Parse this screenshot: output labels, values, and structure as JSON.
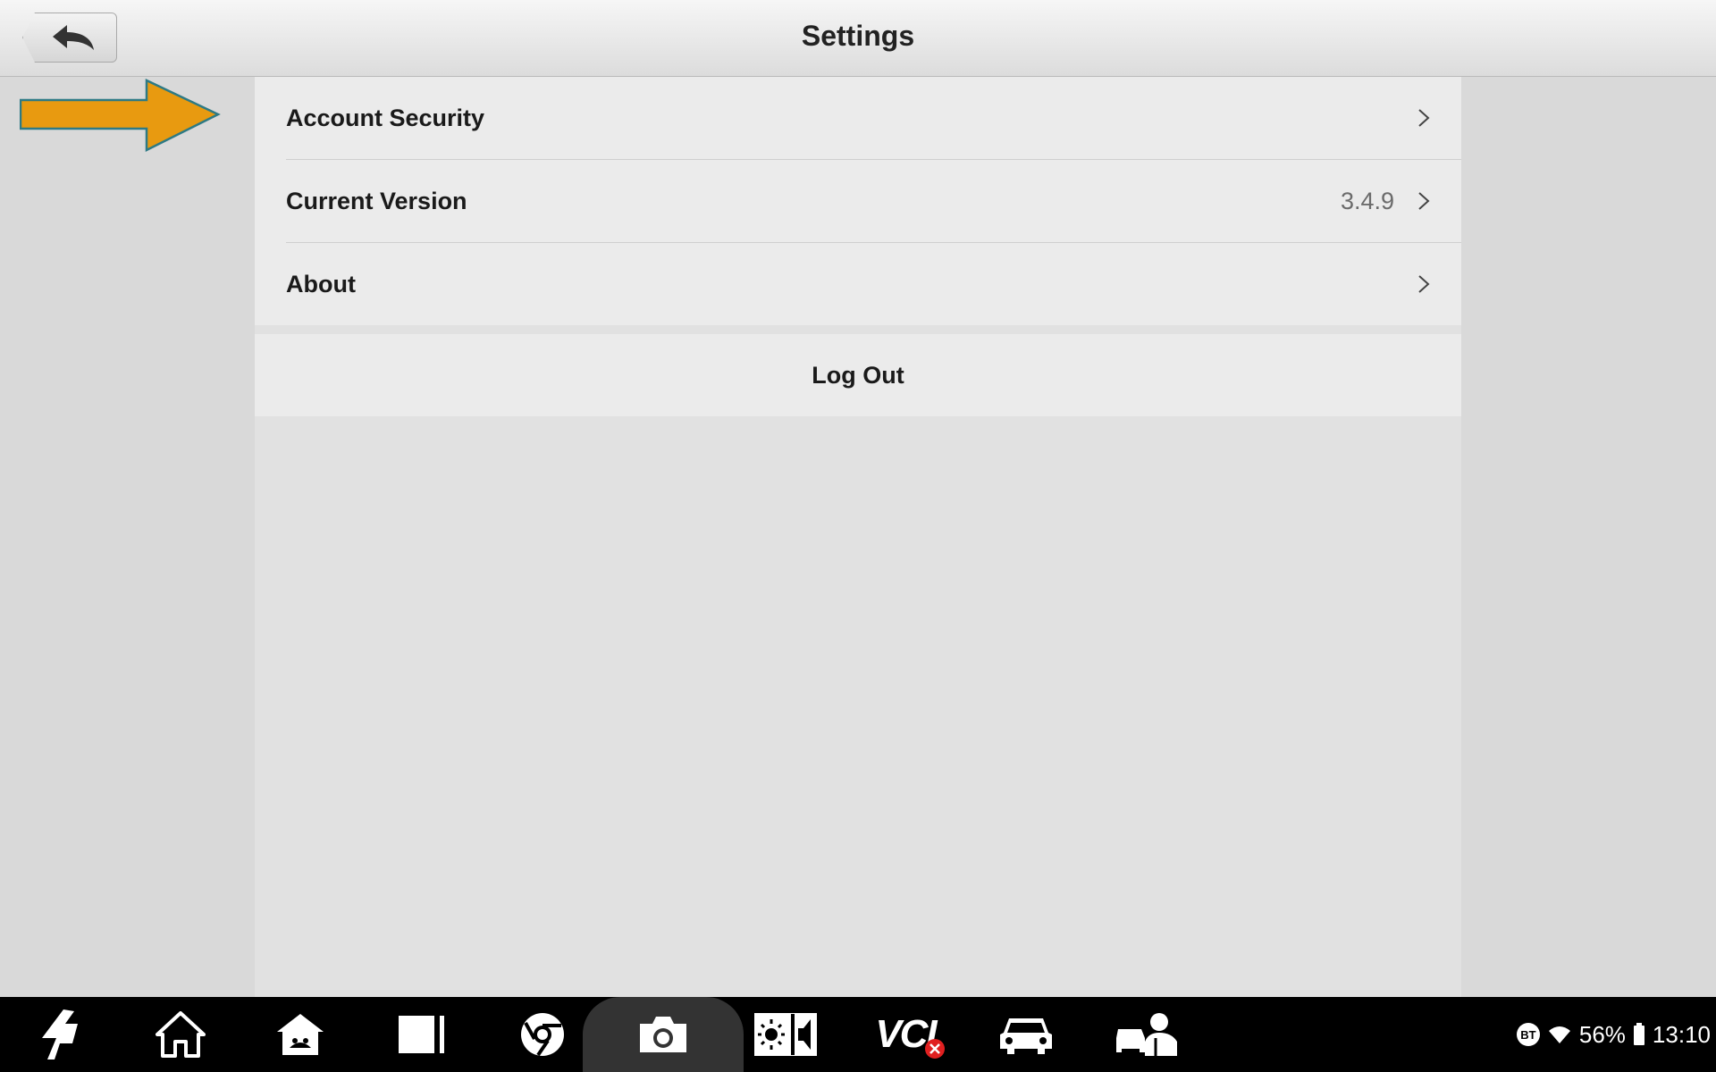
{
  "header": {
    "title": "Settings",
    "back_icon": "back-arrow-icon"
  },
  "annotation": {
    "arrow_color": "#E89A10",
    "arrow_outline": "#2D7A85"
  },
  "settings": {
    "items": [
      {
        "label": "Account Security",
        "value": ""
      },
      {
        "label": "Current Version",
        "value": "3.4.9"
      },
      {
        "label": "About",
        "value": ""
      }
    ],
    "logout_label": "Log Out"
  },
  "taskbar": {
    "icons": [
      "autel-logo-icon",
      "home-icon",
      "android-home-icon",
      "recent-apps-icon",
      "browser-icon",
      "camera-icon",
      "brightness-volume-icon",
      "vci-icon",
      "car-icon",
      "technician-icon"
    ],
    "vci_label": "VCI"
  },
  "status_bar": {
    "bt_label": "BT",
    "battery": "56%",
    "time": "13:10"
  }
}
